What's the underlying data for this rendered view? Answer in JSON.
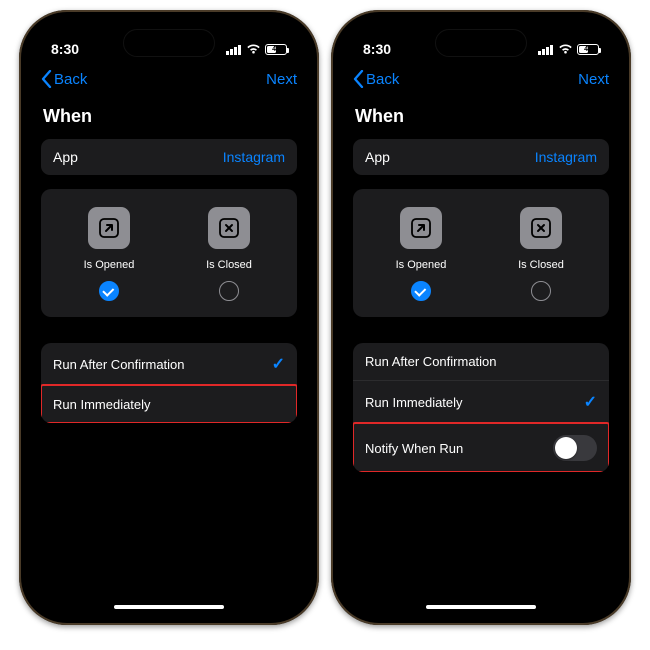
{
  "status": {
    "time": "8:30",
    "battery": "44"
  },
  "nav": {
    "back": "Back",
    "next": "Next"
  },
  "page_title": "When",
  "app_row": {
    "label": "App",
    "value": "Instagram"
  },
  "triggers": {
    "opened": {
      "label": "Is Opened"
    },
    "closed": {
      "label": "Is Closed"
    }
  },
  "left": {
    "run_after_confirmation": "Run After Confirmation",
    "run_immediately": "Run Immediately"
  },
  "right": {
    "run_after_confirmation": "Run After Confirmation",
    "run_immediately": "Run Immediately",
    "notify_when_run": "Notify When Run"
  }
}
